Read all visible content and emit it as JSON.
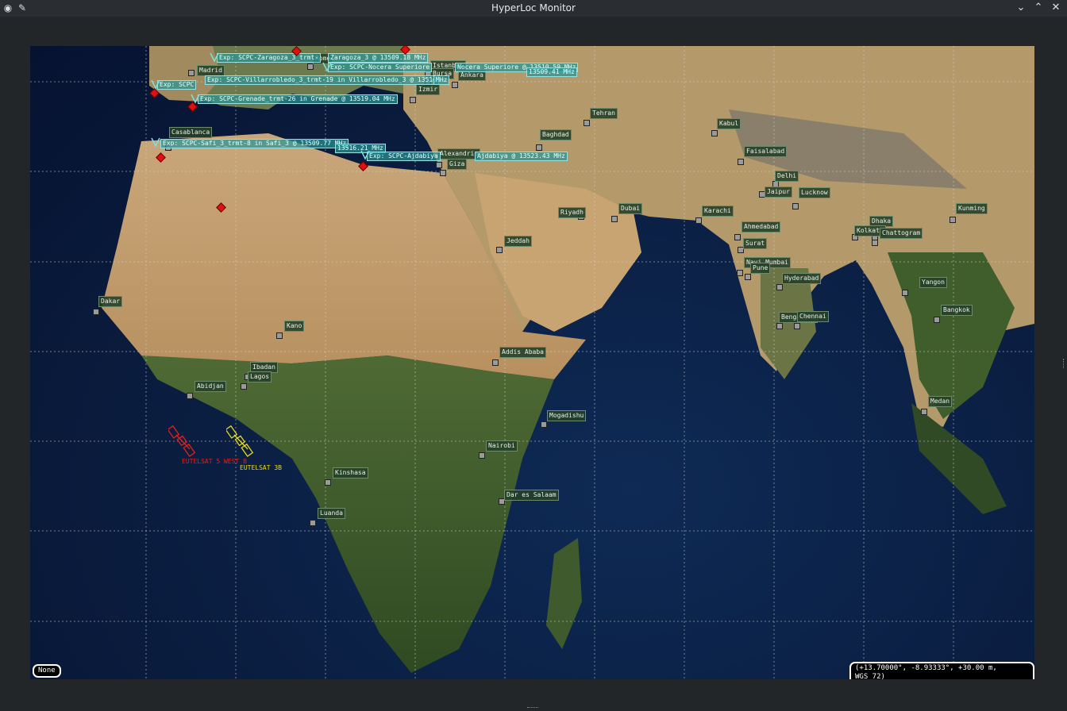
{
  "window": {
    "title": "HyperLoc Monitor"
  },
  "colors": {
    "city_label_bg": "#264028",
    "exp_label_bg": "#2896968",
    "marker": "#e01010",
    "sat_red": "#e0201a",
    "sat_yellow": "#e8d81a"
  },
  "icons": {
    "app": "app-icon",
    "pin": "pin-icon",
    "minimize": "chevron-down-icon",
    "maximize": "chevron-up-icon",
    "close": "close-icon"
  },
  "map": {
    "selection_label": "None",
    "coordinate_readout": "(+13.70000°, -8.93333°, +30.00 m, WGS_72)",
    "cities": [
      {
        "name": "Madrid"
      },
      {
        "name": "Rome"
      },
      {
        "name": "Istanbul"
      },
      {
        "name": "Bursa"
      },
      {
        "name": "Ankara"
      },
      {
        "name": "Izmir"
      },
      {
        "name": "Tehran"
      },
      {
        "name": "Kabul"
      },
      {
        "name": "Baghdad"
      },
      {
        "name": "Casablanca"
      },
      {
        "name": "Alexandria"
      },
      {
        "name": "Giza"
      },
      {
        "name": "Faisalabad"
      },
      {
        "name": "Delhi"
      },
      {
        "name": "Jaipur"
      },
      {
        "name": "Lucknow"
      },
      {
        "name": "Riyadh"
      },
      {
        "name": "Dubai"
      },
      {
        "name": "Karachi"
      },
      {
        "name": "Kunming"
      },
      {
        "name": "Dhaka"
      },
      {
        "name": "Kolkata"
      },
      {
        "name": "Chattogram"
      },
      {
        "name": "Ahmedabad"
      },
      {
        "name": "Surat"
      },
      {
        "name": "Jeddah"
      },
      {
        "name": "Navi Mumbai"
      },
      {
        "name": "Pune"
      },
      {
        "name": "Hyderabad"
      },
      {
        "name": "Yangon"
      },
      {
        "name": "Dakar"
      },
      {
        "name": "Kano"
      },
      {
        "name": "Bengaluru"
      },
      {
        "name": "Chennai"
      },
      {
        "name": "Bangkok"
      },
      {
        "name": "Addis Ababa"
      },
      {
        "name": "Ibadan"
      },
      {
        "name": "Lagos"
      },
      {
        "name": "Abidjan"
      },
      {
        "name": "Medan"
      },
      {
        "name": "Mogadishu"
      },
      {
        "name": "Nairobi"
      },
      {
        "name": "Kinshasa"
      },
      {
        "name": "Dar es Salaam"
      },
      {
        "name": "Luanda"
      }
    ],
    "exploitations": [
      {
        "label": "Exp: SCPC-Zaragoza_3_trmt-"
      },
      {
        "label": "Zaragoza_3 @ 13509.18 MHz"
      },
      {
        "label": "Exp: SCPC-Nocera Superiore"
      },
      {
        "label": "Nocera Superiore @ 13510.59 MHz"
      },
      {
        "label": "13509.41 MHz"
      },
      {
        "label": "Exp: SCPC-Villarrobledo_3_trmt-19 in Villarrobledo_3 @ 13516"
      },
      {
        "label": "MHz"
      },
      {
        "label": "Exp: SCPC"
      },
      {
        "label": "Exp: SCPC-Grenade_trmt-26 in Grenade @ 13519.04 MHz"
      },
      {
        "label": "Exp: SCPC-Safi_3_trmt-8 in Safi_3 @ 13509.77 MHz"
      },
      {
        "label": "13516.21 MHz"
      },
      {
        "label": "Exp: SCPC-Ajdabiya"
      },
      {
        "label": "Ajdabiya @ 13523.43 MHz"
      }
    ],
    "satellites": [
      {
        "name": "EUTELSAT 5 WEST B"
      },
      {
        "name": "EUTELSAT 3B"
      }
    ]
  }
}
